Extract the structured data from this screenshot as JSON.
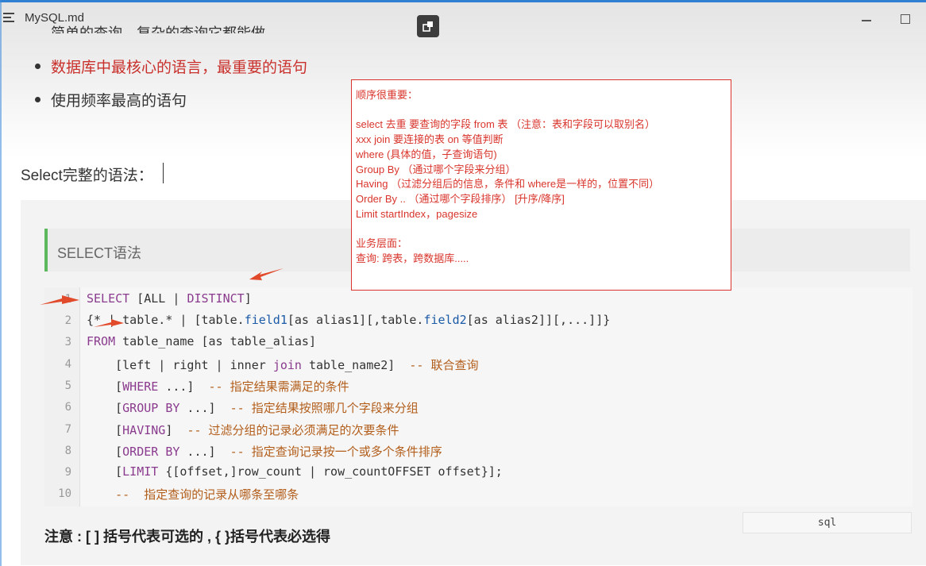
{
  "window": {
    "title": "MySQL.md"
  },
  "doc": {
    "partial_line": "简单的查询，复杂的查询它都能做",
    "bullets": [
      {
        "text": "数据库中最核心的语言，最重要的语句",
        "color": "#c9302c"
      },
      {
        "text": "使用频率最高的语句",
        "color": "#333333"
      }
    ],
    "select_title": "Select完整的语法：",
    "section_title": "SELECT语法",
    "code_lang": "sql",
    "note": "注意 : [ ] 括号代表可选的 , { }括号代表必选得"
  },
  "code": {
    "line_numbers": [
      "1",
      "2",
      "3",
      "4",
      "5",
      "6",
      "7",
      "8",
      "9",
      "10"
    ],
    "lines": [
      "SELECT [ALL | DISTINCT]",
      "{* | table.* | [table.field1[as alias1][,table.field2[as alias2]][,...]]}",
      "FROM table_name [as table_alias]",
      "    [left | right | inner join table_name2]  -- 联合查询",
      "    [WHERE ...]  -- 指定结果需满足的条件",
      "    [GROUP BY ...]  -- 指定结果按照哪几个字段来分组",
      "    [HAVING]  -- 过滤分组的记录必须满足的次要条件",
      "    [ORDER BY ...]  -- 指定查询记录按一个或多个条件排序",
      "    [LIMIT {[offset,]row_count | row_countOFFSET offset}];",
      "    --  指定查询的记录从哪条至哪条"
    ]
  },
  "annotation": {
    "lines": [
      "顺序很重要：",
      "",
      "select 去重 要查询的字段 from 表  （注意：表和字段可以取别名）",
      "xxx join 要连接的表  on  等值判断",
      "where (具体的值，子查询语句)",
      "Group By （通过哪个字段来分组）",
      "Having （过滤分组后的信息，条件和 where是一样的，位置不同）",
      "Order By .. （通过哪个字段排序） [升序/降序]",
      "Limit  startIndex，pagesize",
      "",
      "业务层面：",
      "查询: 跨表，跨数据库....."
    ]
  },
  "icons": {
    "menu": "menu-icon",
    "mid": "restore-icon",
    "minimize": "minimize-icon",
    "maximize": "maximize-icon"
  },
  "colors": {
    "accent": "#2f7fd3",
    "red": "#d9352c",
    "section_bar": "#5cb85c"
  }
}
